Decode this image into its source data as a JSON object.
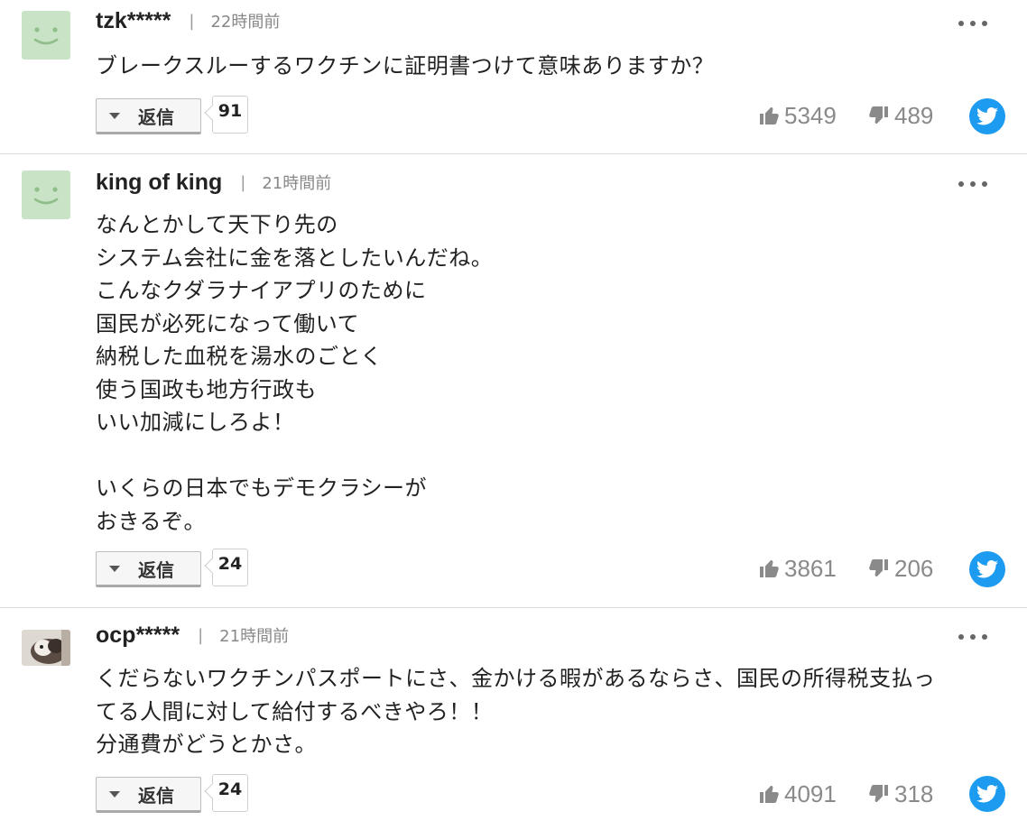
{
  "comments": [
    {
      "username": "tzk*****",
      "separator": "|",
      "time": "22時間前",
      "avatar_icon": "smiley-face-icon",
      "text": "ブレークスルーするワクチンに証明書つけて意味ありますか？",
      "reply_label": "返信",
      "reply_count": "91",
      "likes": "5349",
      "dislikes": "489"
    },
    {
      "username": "king of king",
      "separator": "|",
      "time": "21時間前",
      "avatar_icon": "smiley-face-icon",
      "text": "なんとかして天下り先の\nシステム会社に金を落としたいんだね。\nこんなクダラナイアプリのために\n国民が必死になって働いて\n納税した血税を湯水のごとく\n使う国政も地方行政も\nいい加減にしろよ！\n\nいくらの日本でもデモクラシーが\nおきるぞ。",
      "reply_label": "返信",
      "reply_count": "24",
      "likes": "3861",
      "dislikes": "206"
    },
    {
      "username": "ocp*****",
      "separator": "|",
      "time": "21時間前",
      "avatar_icon": "pet-photo-avatar",
      "text": "くだらないワクチンパスポートにさ、金かける暇があるならさ、国民の所得税支払っ\nてる人間に対して給付するべきやろ！！\n分通費がどうとかさ。",
      "reply_label": "返信",
      "reply_count": "24",
      "likes": "4091",
      "dislikes": "318"
    }
  ],
  "colors": {
    "twitter": "#1d9bf0",
    "avatar_green": "#c9e3c6",
    "divider": "#dcdcdc"
  }
}
